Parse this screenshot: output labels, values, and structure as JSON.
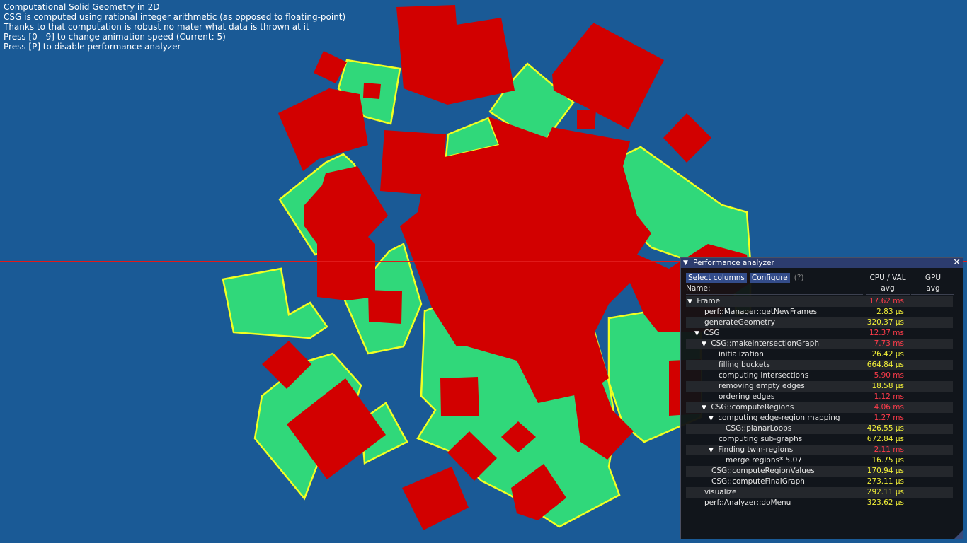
{
  "overlay": {
    "lines": [
      "Computational Solid Geometry in 2D",
      "CSG is computed using rational integer arithmetic (as opposed to floating-point)",
      "Thanks to that computation is robust no mater what data is thrown at it",
      "Press [0 - 9] to change animation speed (Current: 5)",
      "Press [P] to disable performance analyzer"
    ]
  },
  "colors": {
    "background": "#1a5a96",
    "region_green": "#30d87a",
    "region_outline": "#f2ff22",
    "shape_red": "#d20000",
    "value_warn": "#ff3c4a",
    "value_ok": "#f2f038"
  },
  "perf": {
    "title": "Performance analyzer",
    "close_icon": "✕",
    "collapse_icon": "triangle-down-icon",
    "toolbar": {
      "select_columns": "Select columns",
      "configure": "Configure",
      "help": "(?)"
    },
    "header": {
      "name": "Name:",
      "cpu": "CPU / VAL",
      "cpu_sub": "avg",
      "gpu": "GPU",
      "gpu_sub": "avg"
    },
    "rows": [
      {
        "name": "Frame",
        "value": "17.62 ms",
        "status": "warn",
        "depth": 0,
        "expanded": true
      },
      {
        "name": "perf::Manager::getNewFrames",
        "value": "2.83 µs",
        "status": "ok",
        "depth": 1,
        "expanded": false
      },
      {
        "name": "generateGeometry",
        "value": "320.37 µs",
        "status": "ok",
        "depth": 1,
        "expanded": false
      },
      {
        "name": "CSG",
        "value": "12.37 ms",
        "status": "warn",
        "depth": 1,
        "expanded": true
      },
      {
        "name": "CSG::makeIntersectionGraph",
        "value": "7.73 ms",
        "status": "warn",
        "depth": 2,
        "expanded": true
      },
      {
        "name": "initialization",
        "value": "26.42 µs",
        "status": "ok",
        "depth": 3,
        "expanded": false
      },
      {
        "name": "filling buckets",
        "value": "664.84 µs",
        "status": "ok",
        "depth": 3,
        "expanded": false
      },
      {
        "name": "computing intersections",
        "value": "5.90 ms",
        "status": "warn",
        "depth": 3,
        "expanded": false
      },
      {
        "name": "removing empty edges",
        "value": "18.58 µs",
        "status": "ok",
        "depth": 3,
        "expanded": false
      },
      {
        "name": "ordering edges",
        "value": "1.12 ms",
        "status": "warn",
        "depth": 3,
        "expanded": false
      },
      {
        "name": "CSG::computeRegions",
        "value": "4.06 ms",
        "status": "warn",
        "depth": 2,
        "expanded": true
      },
      {
        "name": "computing edge-region mapping",
        "value": "1.27 ms",
        "status": "warn",
        "depth": 3,
        "expanded": true
      },
      {
        "name": "CSG::planarLoops",
        "value": "426.55 µs",
        "status": "ok",
        "depth": 4,
        "expanded": false
      },
      {
        "name": "computing sub-graphs",
        "value": "672.84 µs",
        "status": "ok",
        "depth": 3,
        "expanded": false
      },
      {
        "name": "Finding twin-regions",
        "value": "2.11 ms",
        "status": "warn",
        "depth": 3,
        "expanded": true
      },
      {
        "name": "merge regions* 5.07",
        "value": "16.75 µs",
        "status": "ok",
        "depth": 4,
        "expanded": false
      },
      {
        "name": "CSG::computeRegionValues",
        "value": "170.94 µs",
        "status": "ok",
        "depth": 2,
        "expanded": false
      },
      {
        "name": "CSG::computeFinalGraph",
        "value": "273.11 µs",
        "status": "ok",
        "depth": 2,
        "expanded": false
      },
      {
        "name": "visualize",
        "value": "292.11 µs",
        "status": "ok",
        "depth": 1,
        "expanded": false
      },
      {
        "name": "perf::Analyzer::doMenu",
        "value": "323.62 µs",
        "status": "ok",
        "depth": 1,
        "expanded": false
      }
    ]
  }
}
